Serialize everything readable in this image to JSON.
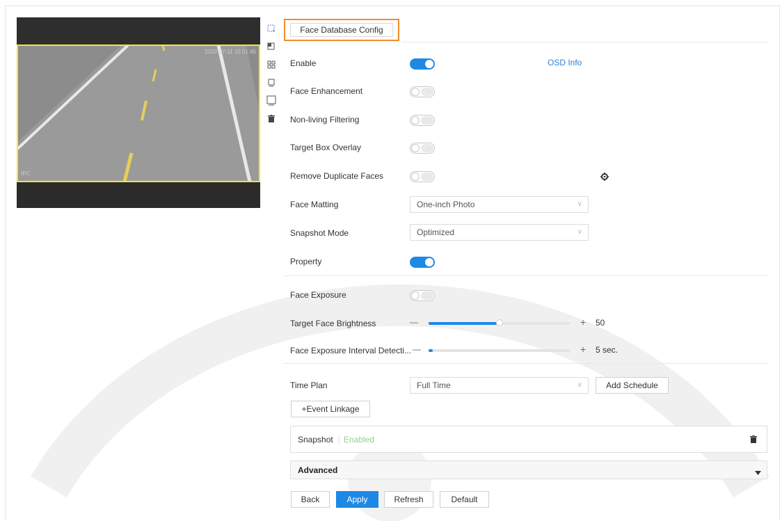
{
  "preview": {
    "timestamp": "2022-07-11 15:01:45",
    "channel_label": "IPC"
  },
  "tab": {
    "label": "Face Database Config"
  },
  "settings": {
    "enable_label": "Enable",
    "enable_on": true,
    "osd_info_label": "OSD Info",
    "face_enhancement_label": "Face Enhancement",
    "face_enhancement_on": false,
    "nonliving_label": "Non-living Filtering",
    "nonliving_on": false,
    "target_box_label": "Target Box Overlay",
    "target_box_on": false,
    "remove_dup_label": "Remove Duplicate Faces",
    "remove_dup_on": false,
    "face_matting_label": "Face Matting",
    "face_matting_value": "One-inch Photo",
    "snapshot_mode_label": "Snapshot Mode",
    "snapshot_mode_value": "Optimized",
    "property_label": "Property",
    "property_on": true
  },
  "exposure": {
    "face_exposure_label": "Face Exposure",
    "face_exposure_on": false,
    "brightness_label": "Target Face Brightness",
    "brightness_value": "50",
    "brightness_level": 0.5,
    "interval_label": "Face Exposure Interval Detecti...",
    "interval_value": "5 sec.",
    "interval_level": 0.02,
    "minus": "—",
    "plus": "+"
  },
  "schedule": {
    "time_plan_label": "Time Plan",
    "time_plan_value": "Full Time",
    "add_schedule_label": "Add Schedule",
    "event_linkage_label": "+Event Linkage",
    "snapshot_label": "Snapshot",
    "snapshot_status": "Enabled"
  },
  "advanced": {
    "label": "Advanced"
  },
  "actions": {
    "back": "Back",
    "apply": "Apply",
    "refresh": "Refresh",
    "default": "Default"
  },
  "colors": {
    "accent": "#1e88e5",
    "tab_highlight": "#f08c28",
    "enabled_text": "#8fd08f",
    "roi_border": "#f5e53a"
  }
}
